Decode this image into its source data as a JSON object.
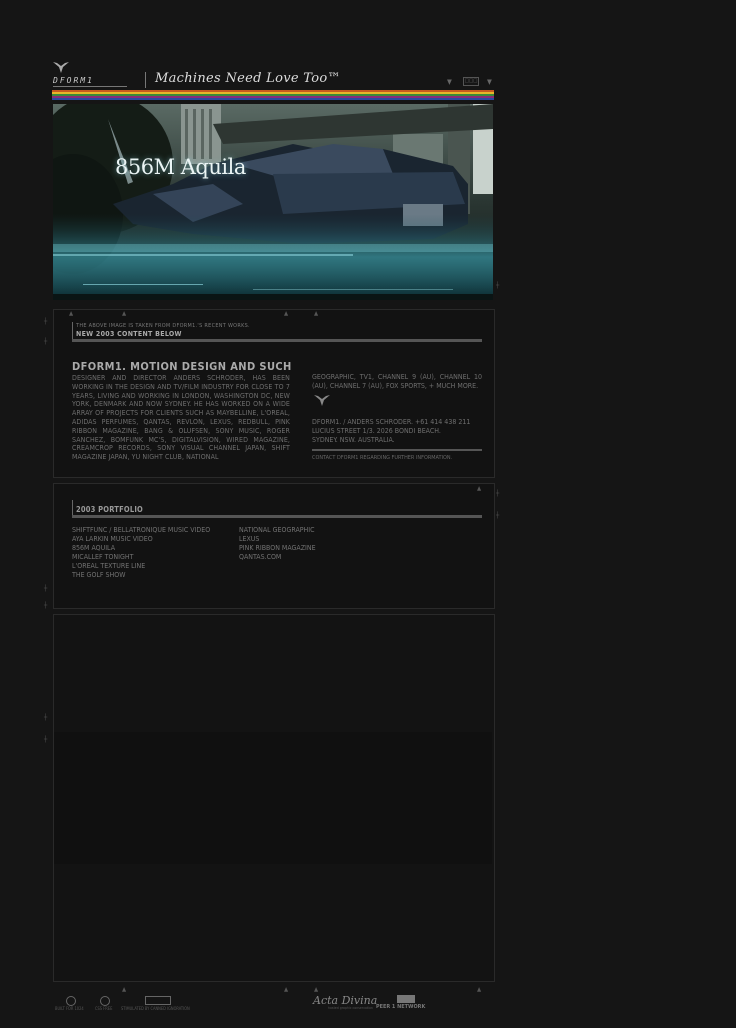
{
  "header": {
    "logo_text": "DFORM1",
    "tagline": "Machines Need Love Too™",
    "nav_box_label": "□□□"
  },
  "colors": {
    "stripes": [
      "#c85a1e",
      "#e8b42a",
      "#3a8a3a",
      "#8a2a7a",
      "#2a4aa0"
    ]
  },
  "hero": {
    "title": "856M Aquila"
  },
  "about": {
    "note": "THE ABOVE IMAGE IS TAKEN FROM DFORM1.'S RECENT WORKS.",
    "new_content": "NEW 2003 CONTENT BELOW",
    "title": "DFORM1. MOTION DESIGN AND SUCH",
    "body": "DESIGNER AND DIRECTOR ANDERS SCHRODER, HAS BEEN WORKING IN THE DESIGN AND TV/FILM INDUSTRY FOR CLOSE TO 7 YEARS, LIVING AND WORKING IN LONDON, WASHINGTON DC, NEW YORK, DENMARK AND NOW SYDNEY. HE HAS WORKED ON A WIDE ARRAY OF PROJECTS FOR CLIENTS SUCH AS MAYBELLINE, L'OREAL, ADIDAS PERFUMES, QANTAS, REVLON, LEXUS, REDBULL, PINK RIBBON MAGAZINE, BANG & OLUFSEN, SONY MUSIC, ROGER SANCHEZ, BOMFUNK MC'S, DIGITALVISION, WIRED MAGAZINE, CREAMCROP RECORDS, SONY VISUAL CHANNEL JAPAN, SHIFT MAGAZINE JAPAN, YU NIGHT CLUB, NATIONAL",
    "body_continued": "GEOGRAPHIC, TV1, CHANNEL 9 (AU), CHANNEL 10 (AU), CHANNEL 7 (AU), FOX SPORTS, + MUCH MORE.",
    "contact_lines": [
      "DFORM1. / ANDERS SCHRODER. +61 414 438 211",
      "LUCIUS STREET 1/3. 2026 BONDI BEACH.",
      "SYDNEY. NSW. AUSTRALIA."
    ],
    "contact_note": "CONTACT DFORM1 REGARDING FURTHER INFORMATION."
  },
  "portfolio": {
    "title": "2003 PORTFOLIO",
    "left_items": [
      "SHIFTFUNC / BELLATRONIQUE MUSIC VIDEO",
      "AYA LARKIN MUSIC VIDEO",
      "856M AQUILA",
      "MICALLEF TONIGHT",
      "L'OREAL TEXTURE LINE",
      "THE GOLF SHOW"
    ],
    "right_items": [
      "NATIONAL GEOGRAPHIC",
      "LEXUS",
      "PINK RIBBON MAGAZINE",
      "QANTAS.COM"
    ]
  },
  "footer": {
    "labels": [
      "BUILT FOR 1024",
      "CSS FREE",
      "STIMULATED BY CANNED IGNORATION"
    ],
    "acta_divina": "Acta Divina",
    "acta_sub": "hosted graphic conservation",
    "peer_network": "PEER 1 NETWORK"
  }
}
